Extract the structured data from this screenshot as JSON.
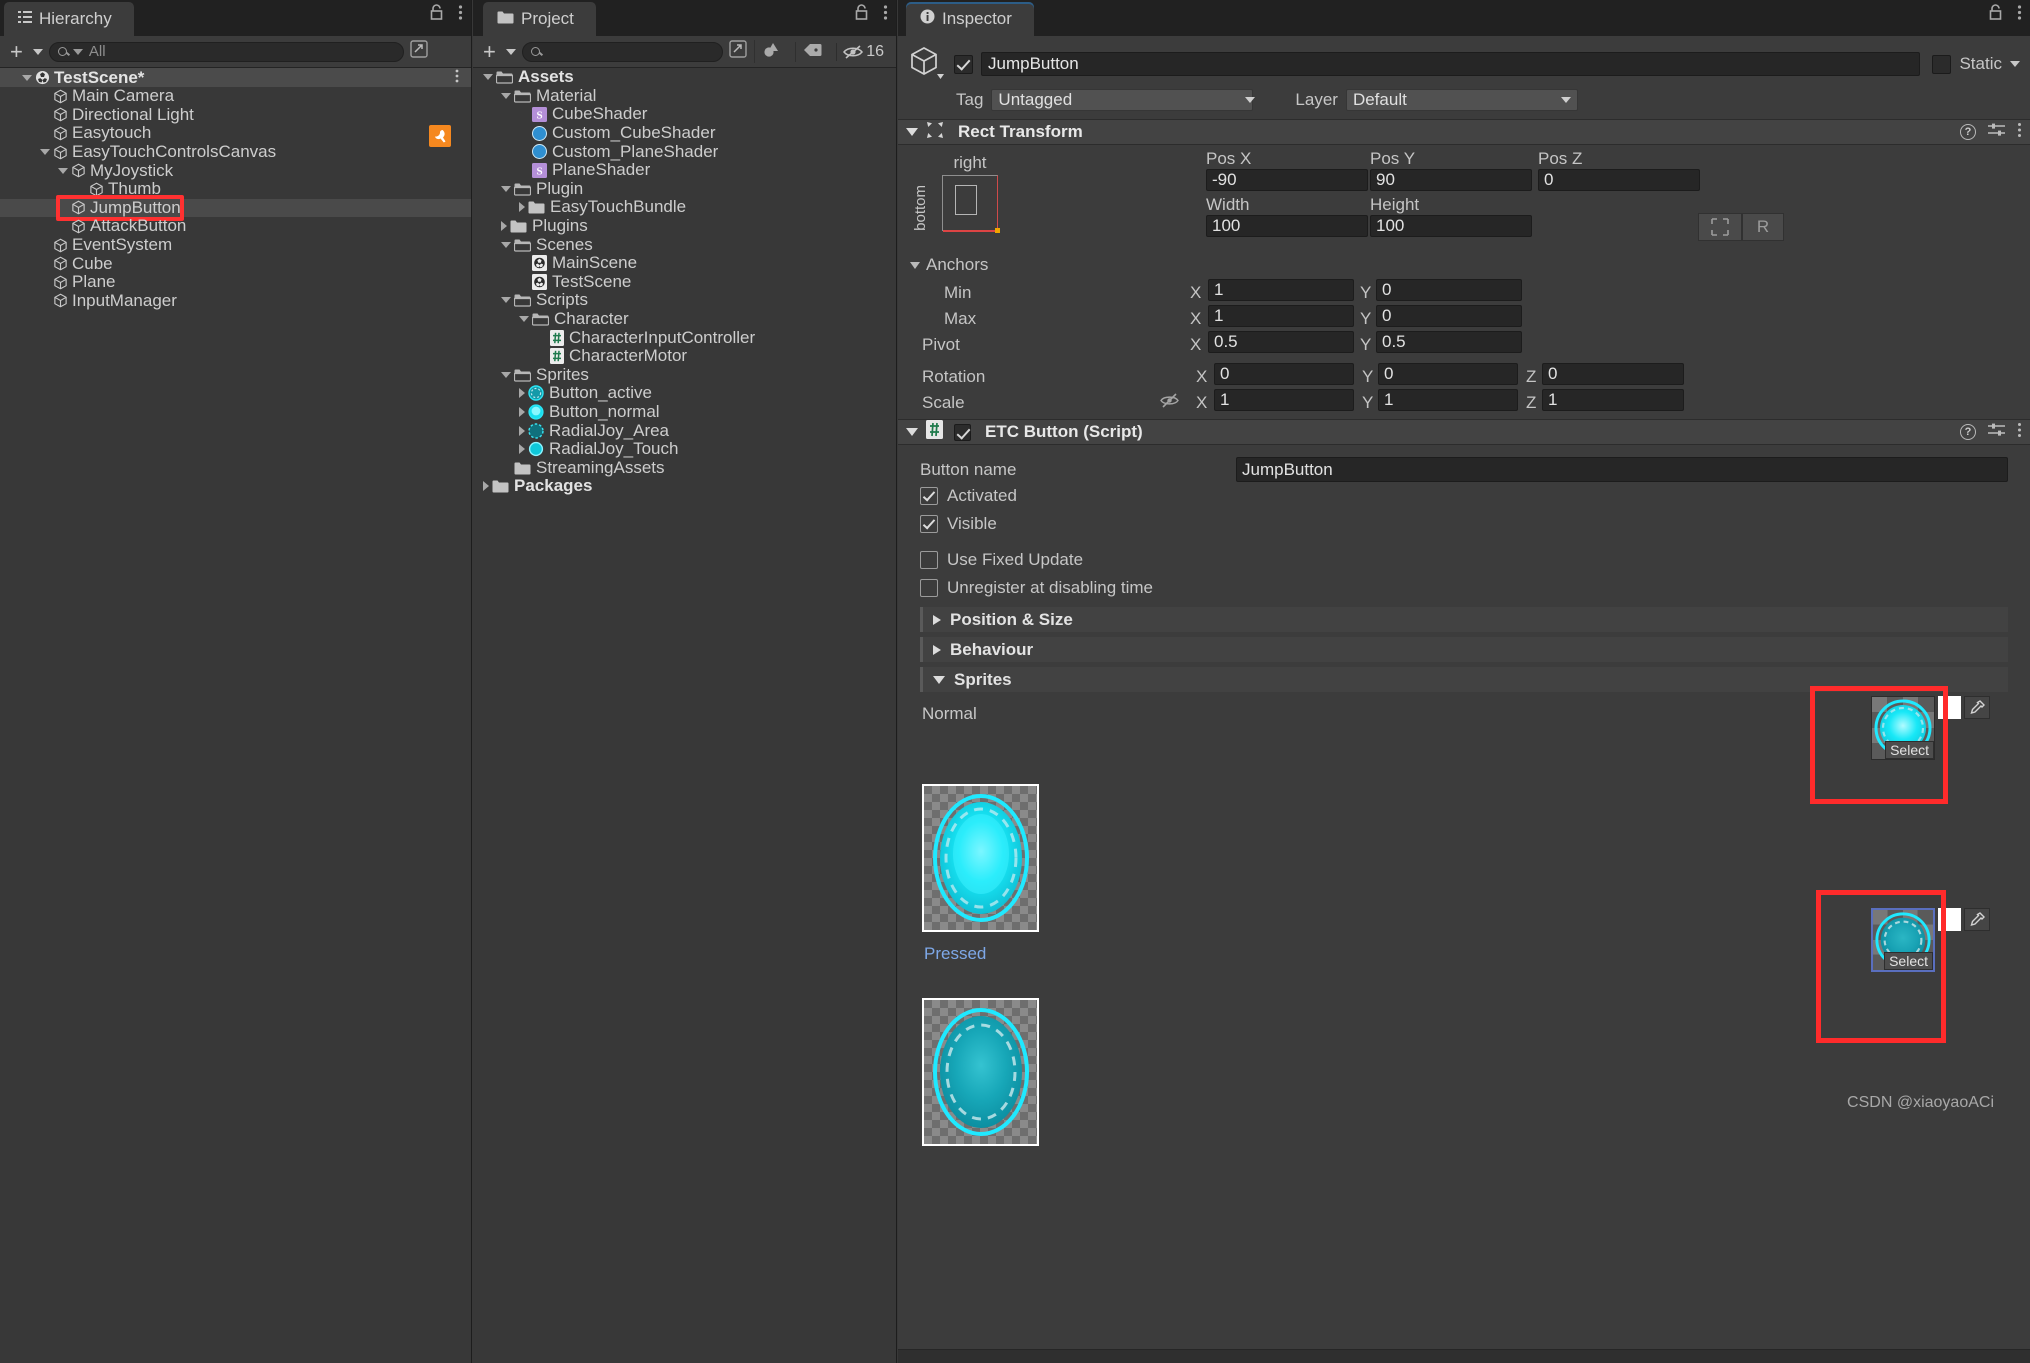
{
  "hierarchy": {
    "tab_label": "Hierarchy",
    "toolbar": {
      "create_label": "+",
      "search_placeholder": "All",
      "search_value": ""
    },
    "items": [
      {
        "label": "TestScene*",
        "depth": 0,
        "arrow": "down",
        "icon": "scene-icon",
        "scene": true
      },
      {
        "label": "Main Camera",
        "depth": 1,
        "arrow": "none",
        "icon": "gameobject-icon"
      },
      {
        "label": "Directional Light",
        "depth": 1,
        "arrow": "none",
        "icon": "gameobject-icon"
      },
      {
        "label": "Easytouch",
        "depth": 1,
        "arrow": "none",
        "icon": "gameobject-icon",
        "badge": "easytouch-badge"
      },
      {
        "label": "EasyTouchControlsCanvas",
        "depth": 1,
        "arrow": "down",
        "icon": "gameobject-icon"
      },
      {
        "label": "MyJoystick",
        "depth": 2,
        "arrow": "down",
        "icon": "gameobject-icon"
      },
      {
        "label": "Thumb",
        "depth": 3,
        "arrow": "none",
        "icon": "gameobject-icon"
      },
      {
        "label": "JumpButton",
        "depth": 2,
        "arrow": "none",
        "icon": "gameobject-icon",
        "selected": true,
        "highlight": true
      },
      {
        "label": "AttackButton",
        "depth": 2,
        "arrow": "none",
        "icon": "gameobject-icon"
      },
      {
        "label": "EventSystem",
        "depth": 1,
        "arrow": "none",
        "icon": "gameobject-icon"
      },
      {
        "label": "Cube",
        "depth": 1,
        "arrow": "none",
        "icon": "gameobject-icon"
      },
      {
        "label": "Plane",
        "depth": 1,
        "arrow": "none",
        "icon": "gameobject-icon"
      },
      {
        "label": "InputManager",
        "depth": 1,
        "arrow": "none",
        "icon": "gameobject-icon"
      }
    ]
  },
  "project": {
    "tab_label": "Project",
    "toolbar": {
      "create_label": "+",
      "search_placeholder": "",
      "hidden_count": "16"
    },
    "items": [
      {
        "label": "Assets",
        "depth": 0,
        "arrow": "down",
        "icon": "folder-open-icon",
        "bold": true
      },
      {
        "label": "Material",
        "depth": 1,
        "arrow": "down",
        "icon": "folder-open-icon"
      },
      {
        "label": "CubeShader",
        "depth": 2,
        "arrow": "none",
        "icon": "shader-icon"
      },
      {
        "label": "Custom_CubeShader",
        "depth": 2,
        "arrow": "none",
        "icon": "material-icon"
      },
      {
        "label": "Custom_PlaneShader",
        "depth": 2,
        "arrow": "none",
        "icon": "material-icon"
      },
      {
        "label": "PlaneShader",
        "depth": 2,
        "arrow": "none",
        "icon": "shader-icon"
      },
      {
        "label": "Plugin",
        "depth": 1,
        "arrow": "down",
        "icon": "folder-open-icon"
      },
      {
        "label": "EasyTouchBundle",
        "depth": 2,
        "arrow": "right",
        "icon": "folder-icon"
      },
      {
        "label": "Plugins",
        "depth": 1,
        "arrow": "right",
        "icon": "folder-icon"
      },
      {
        "label": "Scenes",
        "depth": 1,
        "arrow": "down",
        "icon": "folder-open-icon"
      },
      {
        "label": "MainScene",
        "depth": 2,
        "arrow": "none",
        "icon": "unity-scene-icon"
      },
      {
        "label": "TestScene",
        "depth": 2,
        "arrow": "none",
        "icon": "unity-scene-icon"
      },
      {
        "label": "Scripts",
        "depth": 1,
        "arrow": "down",
        "icon": "folder-open-icon"
      },
      {
        "label": "Character",
        "depth": 2,
        "arrow": "down",
        "icon": "folder-open-icon"
      },
      {
        "label": "CharacterInputController",
        "depth": 3,
        "arrow": "none",
        "icon": "csharp-script-icon"
      },
      {
        "label": "CharacterMotor",
        "depth": 3,
        "arrow": "none",
        "icon": "csharp-script-icon"
      },
      {
        "label": "Sprites",
        "depth": 1,
        "arrow": "down",
        "icon": "folder-open-icon"
      },
      {
        "label": "Button_active",
        "depth": 2,
        "arrow": "right",
        "icon": "sprite-active-icon"
      },
      {
        "label": "Button_normal",
        "depth": 2,
        "arrow": "right",
        "icon": "sprite-normal-icon"
      },
      {
        "label": "RadialJoy_Area",
        "depth": 2,
        "arrow": "right",
        "icon": "sprite-area-icon"
      },
      {
        "label": "RadialJoy_Touch",
        "depth": 2,
        "arrow": "right",
        "icon": "sprite-touch-icon"
      },
      {
        "label": "StreamingAssets",
        "depth": 1,
        "arrow": "none",
        "icon": "folder-icon"
      },
      {
        "label": "Packages",
        "depth": 0,
        "arrow": "right",
        "icon": "folder-icon",
        "bold": true
      }
    ]
  },
  "inspector": {
    "tab_label": "Inspector",
    "object_name": "JumpButton",
    "object_enabled": true,
    "static_label": "Static",
    "static_checked": false,
    "tag_label": "Tag",
    "tag_value": "Untagged",
    "layer_label": "Layer",
    "layer_value": "Default",
    "rect_transform": {
      "title": "Rect Transform",
      "anchor_preset_top": "right",
      "anchor_preset_left": "bottom",
      "pos_x_label": "Pos X",
      "pos_x": "-90",
      "pos_y_label": "Pos Y",
      "pos_y": "90",
      "pos_z_label": "Pos Z",
      "pos_z": "0",
      "width_label": "Width",
      "width": "100",
      "height_label": "Height",
      "height": "100",
      "blueprint_label": "",
      "raw_label": "R",
      "anchors_label": "Anchors",
      "min_label": "Min",
      "min_x": "1",
      "min_y": "0",
      "max_label": "Max",
      "max_x": "1",
      "max_y": "0",
      "pivot_label": "Pivot",
      "pivot_x": "0.5",
      "pivot_y": "0.5",
      "rotation_label": "Rotation",
      "rot_x": "0",
      "rot_y": "0",
      "rot_z": "0",
      "scale_label": "Scale",
      "scale_x": "1",
      "scale_y": "1",
      "scale_z": "1",
      "x_axis": "X",
      "y_axis": "Y",
      "z_axis": "Z"
    },
    "etc_button": {
      "title": "ETC Button (Script)",
      "enabled": true,
      "button_name_label": "Button name",
      "button_name_value": "JumpButton",
      "activated_label": "Activated",
      "activated": true,
      "visible_label": "Visible",
      "visible": true,
      "use_fixed_update_label": "Use Fixed Update",
      "use_fixed_update": false,
      "unregister_label": "Unregister at disabling time",
      "unregister": false,
      "position_size_label": "Position & Size",
      "behaviour_label": "Behaviour",
      "sprites_label": "Sprites",
      "normal_label": "Normal",
      "pressed_label": "Pressed",
      "select_label": "Select"
    },
    "watermark": "CSDN @xiaoyaoACi"
  },
  "colors": {
    "accent_red": "#ff2b2b",
    "panel_bg": "#383838",
    "inspector_bg": "#3c3c3c",
    "selection_blue": "#5a6fbf",
    "sprite_cyan": "#16e3f0",
    "link_blue": "#7ea8e8",
    "easytouch_orange": "#f5881f"
  }
}
